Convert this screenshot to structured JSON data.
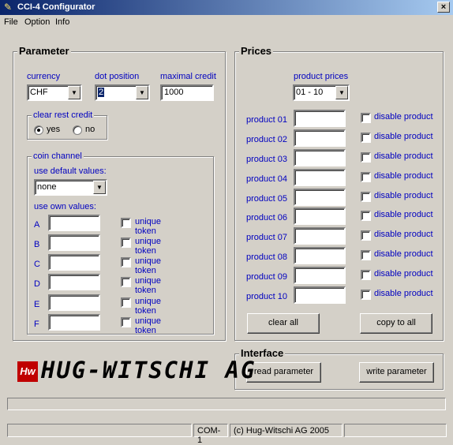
{
  "window": {
    "title": "CCI-4 Configurator",
    "close_glyph": "×",
    "app_icon": "tool-icon"
  },
  "menu": [
    "File",
    "Option",
    "Info"
  ],
  "parameter": {
    "title": "Parameter",
    "currency_label": "currency",
    "currency_value": "CHF",
    "dot_position_label": "dot position",
    "dot_position_value": "2",
    "maximal_credit_label": "maximal credit",
    "maximal_credit_value": "1000",
    "clear_rest_credit": {
      "title": "clear rest credit",
      "yes": "yes",
      "no": "no",
      "selected": "yes"
    },
    "coin_channel": {
      "title": "coin channel",
      "use_default_label": "use default values:",
      "default_value": "none",
      "use_own_label": "use own values:",
      "unique_label": "unique token",
      "channels": [
        {
          "letter": "A",
          "value": ""
        },
        {
          "letter": "B",
          "value": ""
        },
        {
          "letter": "C",
          "value": ""
        },
        {
          "letter": "D",
          "value": ""
        },
        {
          "letter": "E",
          "value": ""
        },
        {
          "letter": "F",
          "value": ""
        }
      ]
    }
  },
  "prices": {
    "title": "Prices",
    "product_prices_label": "product prices",
    "range_value": "01 - 10",
    "disable_label": "disable product",
    "products": [
      {
        "label": "product 01",
        "value": ""
      },
      {
        "label": "product 02",
        "value": ""
      },
      {
        "label": "product 03",
        "value": ""
      },
      {
        "label": "product 04",
        "value": ""
      },
      {
        "label": "product 05",
        "value": ""
      },
      {
        "label": "product 06",
        "value": ""
      },
      {
        "label": "product 07",
        "value": ""
      },
      {
        "label": "product 08",
        "value": ""
      },
      {
        "label": "product 09",
        "value": ""
      },
      {
        "label": "product 10",
        "value": ""
      }
    ],
    "clear_all": "clear all",
    "copy_to_all": "copy to all"
  },
  "interface": {
    "title": "Interface",
    "read": "read parameter",
    "write": "write parameter"
  },
  "logo": {
    "mark": "Hw",
    "text": "HUG-WITSCHI AG"
  },
  "statusbar": {
    "port": "COM-1",
    "copyright": "(c) Hug-Witschi AG 2005"
  }
}
